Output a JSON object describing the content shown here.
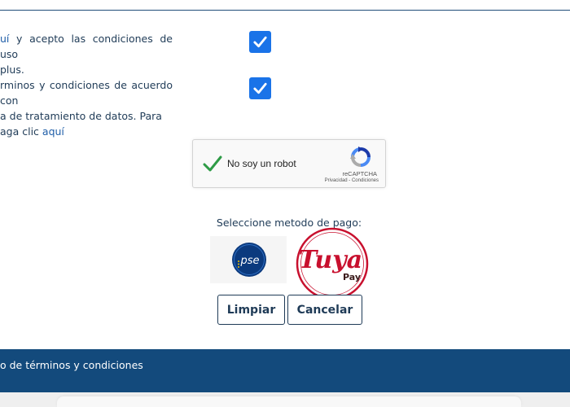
{
  "terms": {
    "item1": {
      "link_text": "uí",
      "text_after_link": " y acepto las condiciones de uso",
      "line2": "plus."
    },
    "item2": {
      "line1": "rminos y condiciones de acuerdo con",
      "line2": "a de tratamiento de datos. Para",
      "line3_prefix": "aga clic ",
      "link_text": "aquí"
    }
  },
  "recaptcha": {
    "label": "No soy un robot",
    "brand": "reCAPTCHA",
    "privacy": "Privacidad",
    "separator": " - ",
    "conditions": "Condiciones"
  },
  "payment": {
    "label": "Seleccione metodo de pago:",
    "pse_text": "pse",
    "tuya_text": "Tuya",
    "tuya_pay": "Pay"
  },
  "buttons": {
    "clear_label": "Limpiar",
    "cancel_label": "Cancelar"
  },
  "footer": {
    "text": "o de términos y condiciones"
  },
  "colors": {
    "checkbox": "#1a73e8",
    "primary_text": "#1f3b57",
    "link": "#1f5ea8",
    "footer_bg": "#134a7c",
    "tuya_red": "#c8102e",
    "pse_blue": "#0b3a7e"
  }
}
